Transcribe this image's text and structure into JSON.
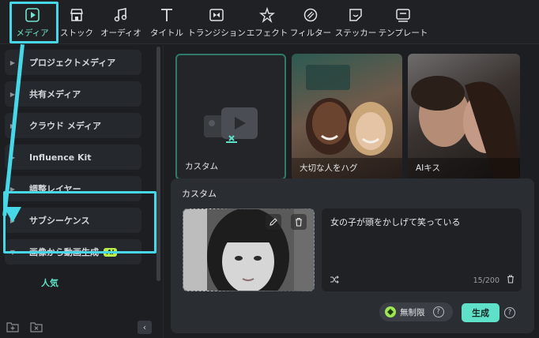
{
  "toolbar": {
    "items": [
      {
        "label": "メディア",
        "icon": "media-icon",
        "active": true
      },
      {
        "label": "ストック",
        "icon": "stock-icon"
      },
      {
        "label": "オーディオ",
        "icon": "music-note-icon"
      },
      {
        "label": "タイトル",
        "icon": "title-t-icon"
      },
      {
        "label": "トランジション",
        "icon": "transition-icon"
      },
      {
        "label": "エフェクト",
        "icon": "effect-star-icon"
      },
      {
        "label": "フィルター",
        "icon": "filter-icon"
      },
      {
        "label": "ステッカー",
        "icon": "sticker-icon"
      },
      {
        "label": "テンプレート",
        "icon": "template-icon"
      }
    ]
  },
  "sidebar": {
    "items": [
      {
        "label": "プロジェクトメディア"
      },
      {
        "label": "共有メディア"
      },
      {
        "label": "クラウド メディア"
      },
      {
        "label": "Influence Kit"
      },
      {
        "label": "調整レイヤー"
      },
      {
        "label": "サブシーケンス"
      },
      {
        "label": "画像から動画生成",
        "badge": "AI"
      }
    ],
    "sub_item": "人気"
  },
  "cards": [
    {
      "caption": "カスタム"
    },
    {
      "caption": "大切な人をハグ"
    },
    {
      "caption": "AIキス"
    }
  ],
  "panel": {
    "title": "カスタム",
    "prompt": "女の子が頭をかしげて笑っている",
    "count": "15/200",
    "unlimited_label": "無制限",
    "help": "?",
    "generate_label": "生成"
  },
  "colors": {
    "accent": "#5fe0c8",
    "highlight": "#47d7e6",
    "ai_badge": "#b9ee4a"
  }
}
